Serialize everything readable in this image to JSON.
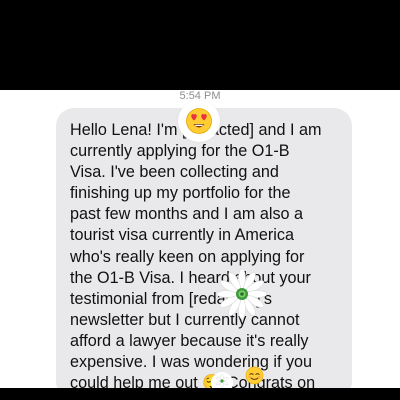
{
  "timestamp": "5:54 PM",
  "message": {
    "text": "Hello Lena! I'm [redacted] and I am\ncurrently applying for the O1-B\nVisa. I've been collecting and\nfinishing up my portfolio for the\npast few months and I am also a\ntourist visa currently in America\nwho's really keen on applying for\nthe O1-B Visa. I heard about your\ntestimonial from [redacted]'s\nnewsletter but I currently cannot\nafford a lawyer because it's really\nexpensive. I was wondering if you\ncould help me out 😌 Congrats on"
  },
  "reactions": {
    "heart_eyes": "heart-eyes-emoji",
    "daisy": "daisy-flower-icon",
    "relieved": "relieved-face-emoji"
  },
  "colors": {
    "bubble": "#e9e9eb",
    "text": "#111111",
    "timestamp": "#8e8e93",
    "frame": "#000000"
  }
}
